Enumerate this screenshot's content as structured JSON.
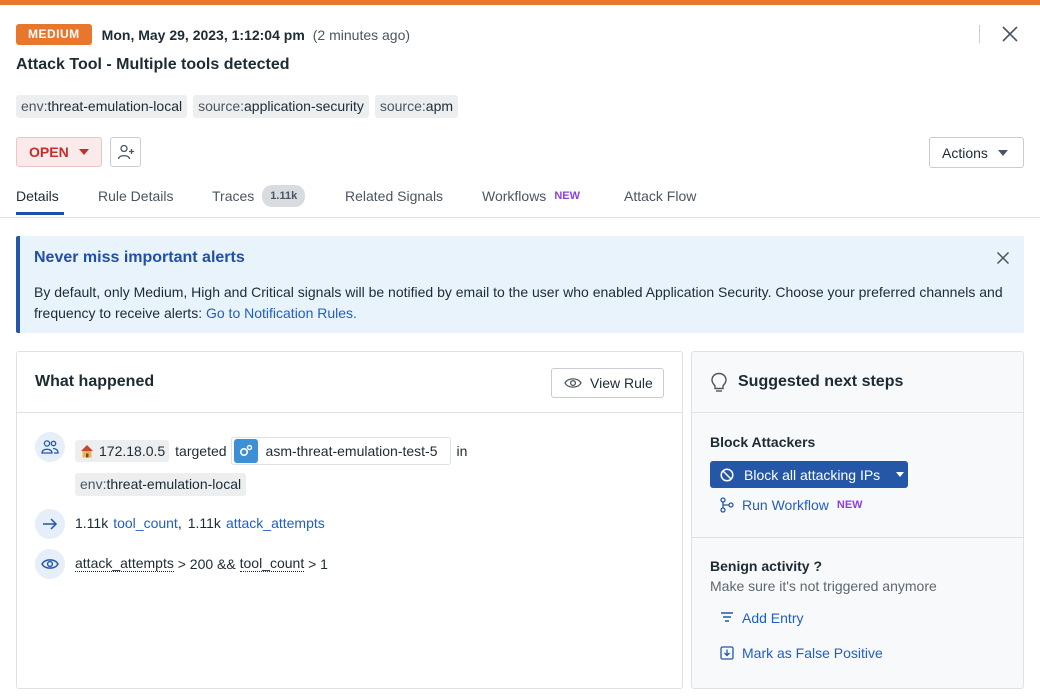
{
  "header": {
    "severity": "MEDIUM",
    "timestamp": "Mon, May 29, 2023, 1:12:04 pm",
    "relative_time": "(2 minutes ago)",
    "title": "Attack Tool - Multiple tools detected",
    "tags": [
      {
        "key": "env:",
        "value": "threat-emulation-local"
      },
      {
        "key": "source:",
        "value": "application-security"
      },
      {
        "key": "source:",
        "value": "apm"
      }
    ],
    "status": "OPEN",
    "actions_label": "Actions"
  },
  "tabs": [
    {
      "label": "Details"
    },
    {
      "label": "Rule Details"
    },
    {
      "label": "Traces",
      "count": "1.11k"
    },
    {
      "label": "Related Signals"
    },
    {
      "label": "Workflows",
      "badge": "NEW"
    },
    {
      "label": "Attack Flow"
    }
  ],
  "banner": {
    "title": "Never miss important alerts",
    "text": "By default, only Medium, High and Critical signals will be notified by email to the user who enabled Application Security. Choose your preferred channels and frequency to receive alerts: ",
    "link": "Go to Notification Rules."
  },
  "what_happened": {
    "title": "What happened",
    "view_rule_label": "View Rule",
    "ip": "172.18.0.5",
    "targeted": "targeted",
    "service": "asm-threat-emulation-test-5",
    "in": "in",
    "env_key": "env:",
    "env_value": "threat-emulation-local",
    "count1": "1.11k",
    "metric1": "tool_count",
    "count2": "1.11k",
    "metric2": "attack_attempts",
    "cond_a": "attack_attempts",
    "cond_mid": " > 200 && ",
    "cond_b": "tool_count",
    "cond_end": " > 1"
  },
  "next_steps": {
    "title": "Suggested next steps",
    "block_title": "Block Attackers",
    "block_btn": "Block all attacking IPs",
    "run_workflow": "Run Workflow",
    "run_workflow_badge": "NEW",
    "benign_title": "Benign activity ?",
    "benign_subtitle": "Make sure it's not triggered anymore",
    "add_entry": "Add Entry",
    "false_positive": "Mark as False Positive"
  },
  "colors": {
    "severity_medium": "#e8762d",
    "accent_blue": "#2457a8",
    "status_red": "#c22e2e",
    "new_purple": "#8f3fe0"
  }
}
